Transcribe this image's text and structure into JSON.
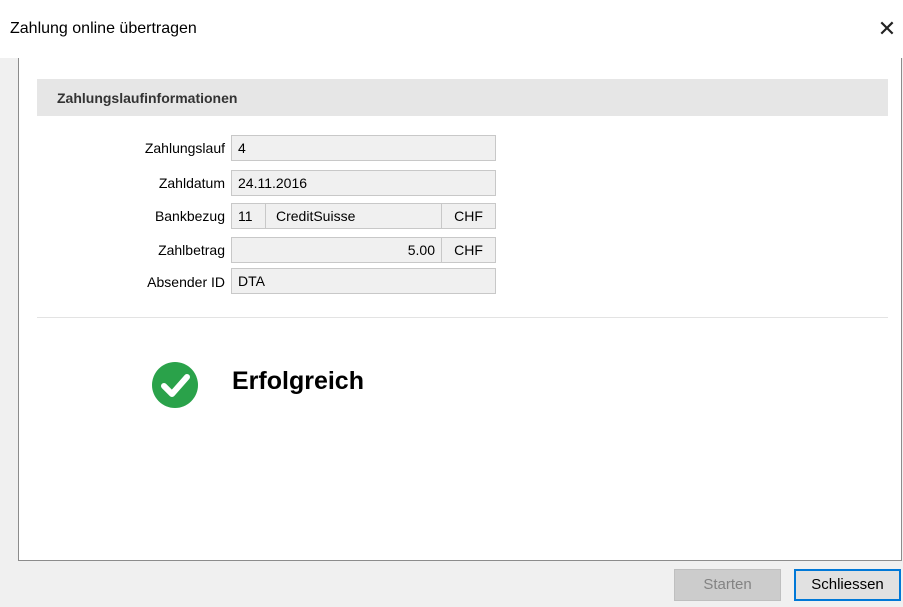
{
  "window": {
    "title": "Zahlung online übertragen",
    "close_glyph": "✕"
  },
  "section": {
    "title": "Zahlungslaufinformationen"
  },
  "fields": {
    "zahlungslauf": {
      "label": "Zahlungslauf",
      "value": "4"
    },
    "zahldatum": {
      "label": "Zahldatum",
      "value": "24.11.2016"
    },
    "bankbezug": {
      "label": "Bankbezug",
      "number": "11",
      "bank": "CreditSuisse",
      "currency": "CHF"
    },
    "zahlbetrag": {
      "label": "Zahlbetrag",
      "amount": "5.00",
      "currency": "CHF"
    },
    "absender_id": {
      "label": "Absender ID",
      "value": "DTA"
    }
  },
  "status": {
    "text": "Erfolgreich",
    "icon": "check-circle-icon",
    "color": "#2aa24a"
  },
  "buttons": {
    "start_label": "Starten",
    "start_enabled": false,
    "close_label": "Schliessen"
  },
  "colors": {
    "accent": "#0078d7",
    "section_bg": "#e6e6e6",
    "field_bg": "#f0f0f0"
  }
}
